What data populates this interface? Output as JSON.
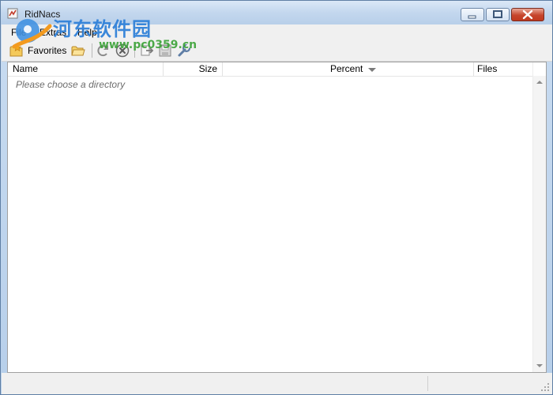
{
  "window": {
    "title": "RidNacs",
    "controls": {
      "minimize": "minimize-icon",
      "maximize": "maximize-icon",
      "close": "close-icon"
    }
  },
  "watermark": {
    "cn_text": "河东软件园",
    "url": "www.pc0359.cn"
  },
  "menu": {
    "items": [
      "File",
      "Extras",
      "Help"
    ]
  },
  "toolbar": {
    "favorites_label": "Favorites",
    "icons": [
      "favorites-folder-icon",
      "open-folder-icon",
      "refresh-icon",
      "stop-icon",
      "export-icon",
      "save-icon",
      "settings-wrench-icon"
    ]
  },
  "list": {
    "columns": [
      {
        "label": "Name"
      },
      {
        "label": "Size"
      },
      {
        "label": "Percent",
        "sorted": true
      },
      {
        "label": "Files"
      }
    ],
    "placeholder": "Please choose a directory"
  },
  "colors": {
    "titlebar": "#c3d7ee",
    "close_button": "#c6452c",
    "watermark_cn": "#2c7fd8",
    "watermark_url": "#3aa236",
    "placeholder_text": "#6d6d6d"
  }
}
